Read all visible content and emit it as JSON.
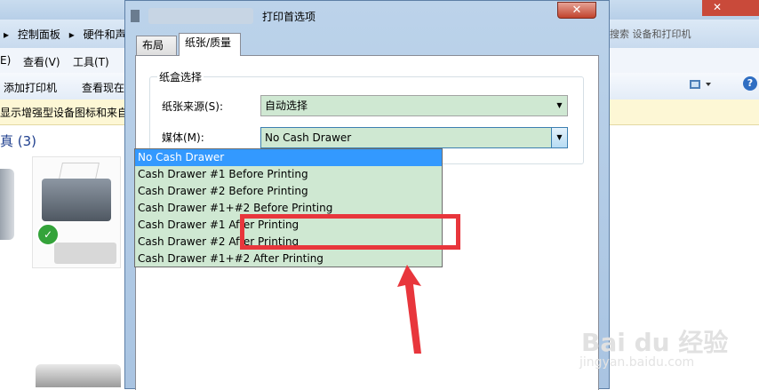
{
  "explorer": {
    "breadcrumb": [
      "▸",
      "控制面板",
      "▸",
      "硬件和声"
    ],
    "search_placeholder": "搜索 设备和打印机",
    "menu": [
      "E)",
      "查看(V)",
      "工具(T)"
    ],
    "commands": [
      "添加打印机",
      "查看现在"
    ],
    "info_text": "显示增强型设备图标和来自",
    "group_header": "真 (3)"
  },
  "dialog": {
    "title": "打印首选项",
    "close_label": "✕",
    "tabs": [
      {
        "label": "布局",
        "active": false
      },
      {
        "label": "纸张/质量",
        "active": true
      }
    ],
    "paper_group": {
      "title": "纸盒选择",
      "source_label": "纸张来源(S):",
      "source_value": "自动选择",
      "media_label": "媒体(M):",
      "media_value": "No Cash Drawer"
    },
    "dropdown": {
      "options": [
        "No Cash Drawer",
        "Cash Drawer #1 Before Printing",
        "Cash Drawer #2 Before Printing",
        "Cash Drawer #1+#2 Before Printing",
        "Cash Drawer #1 After Printing",
        "Cash Drawer #2 After Printing",
        "Cash Drawer #1+#2 After Printing"
      ],
      "selected_index": 0
    }
  },
  "watermark": {
    "text": "Bai du 经验",
    "sub": "jingyan.baidu.com"
  },
  "colors": {
    "selection": "#3399ff",
    "field_bg": "#cfe8d2",
    "annotation": "#e8363c"
  }
}
